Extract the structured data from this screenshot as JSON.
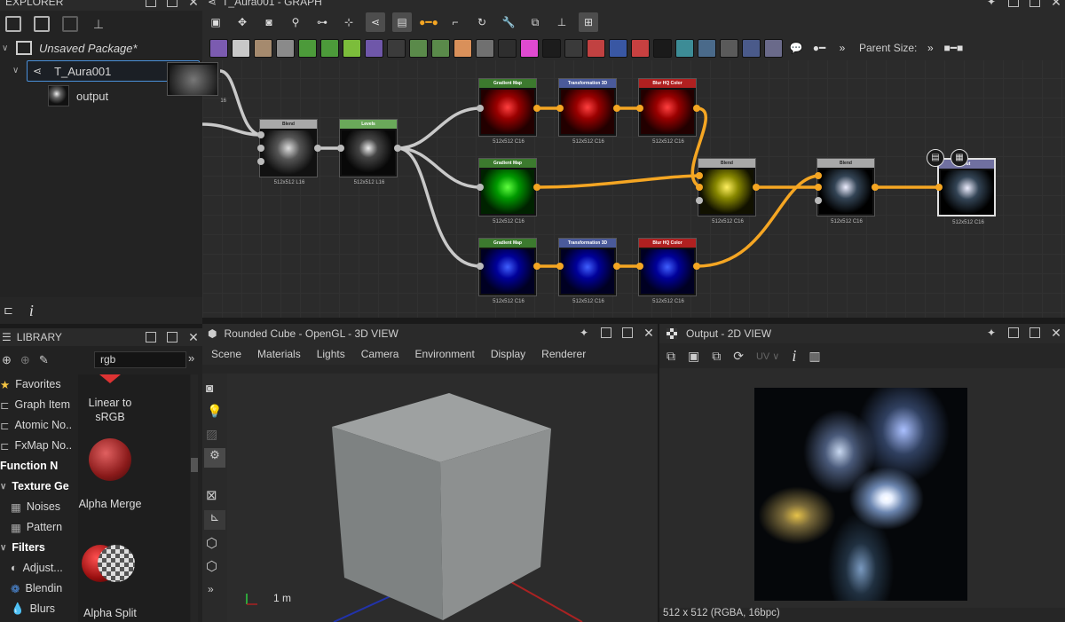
{
  "explorer": {
    "title": "EXPLORER",
    "package_label": "Unsaved Package*",
    "graph_label": "T_Aura001",
    "output_label": "output"
  },
  "graph": {
    "title": "T_Aura001 - GRAPH",
    "parent_size_label": "Parent Size:",
    "node_titles": {
      "blend1": "Blend",
      "levels": "Levels",
      "gmap_r": "Gradient Map",
      "gmap_g": "Gradient Map",
      "gmap_b": "Gradient Map",
      "t3d_r": "Transformation 3D",
      "t3d_b": "Transformation 3D",
      "lut_r": "Blur HQ Color",
      "lut_b": "Blur HQ Color",
      "blend2": "Blend",
      "blend3": "Blend",
      "out": "Out"
    },
    "footer_l16": "512x512   L16",
    "footer_c16": "512x512   C16",
    "left_node_footer": "16",
    "accent_color": "#f5a623"
  },
  "library": {
    "title": "LIBRARY",
    "search_value": "rgb",
    "categories": [
      "Favorites",
      "Graph Item",
      "Atomic No..",
      "FxMap No..",
      "Function N",
      "Texture Ge",
      "Noises",
      "Pattern",
      "Filters",
      "Adjust...",
      "Blendin",
      "Blurs"
    ],
    "items": [
      "Linear to sRGB",
      "Alpha Merge",
      "Alpha Split"
    ]
  },
  "view3d": {
    "title": "Rounded Cube - OpenGL - 3D VIEW",
    "menu": [
      "Scene",
      "Materials",
      "Lights",
      "Camera",
      "Environment",
      "Display",
      "Renderer"
    ],
    "scale_label": "1 m"
  },
  "view2d": {
    "title": "Output - 2D VIEW",
    "uv_label": "UV",
    "status": "512 x 512 (RGBA, 16bpc)"
  }
}
